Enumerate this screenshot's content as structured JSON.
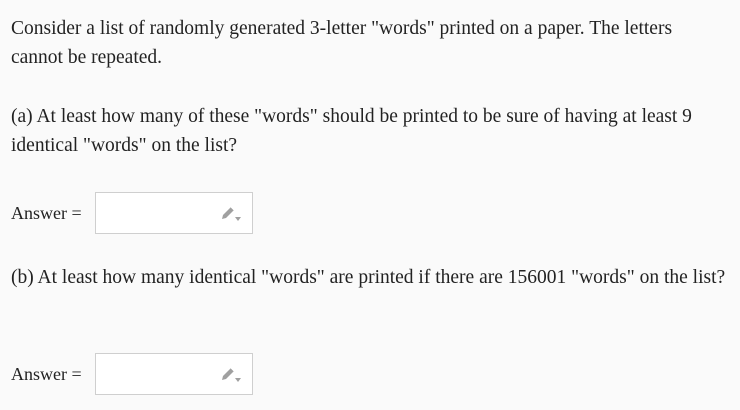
{
  "question": {
    "intro": "Consider a list of randomly generated 3-letter \"words\" printed on a paper. The letters cannot be repeated.",
    "part_a": "(a) At least how many of these \"words\" should be printed to be sure of having at least 9 identical \"words\" on the list?",
    "part_b": "(b) At least how many identical \"words\" are printed if there are 156001 \"words\" on the list?"
  },
  "answers": {
    "a": {
      "label": "Answer =",
      "value": "",
      "icon": "pencil-icon"
    },
    "b": {
      "label": "Answer =",
      "value": "",
      "icon": "pencil-icon"
    }
  },
  "colors": {
    "background": "#fafafa",
    "text": "#222222",
    "input_border": "#cfcfcf",
    "icon": "#9a9a9a"
  }
}
